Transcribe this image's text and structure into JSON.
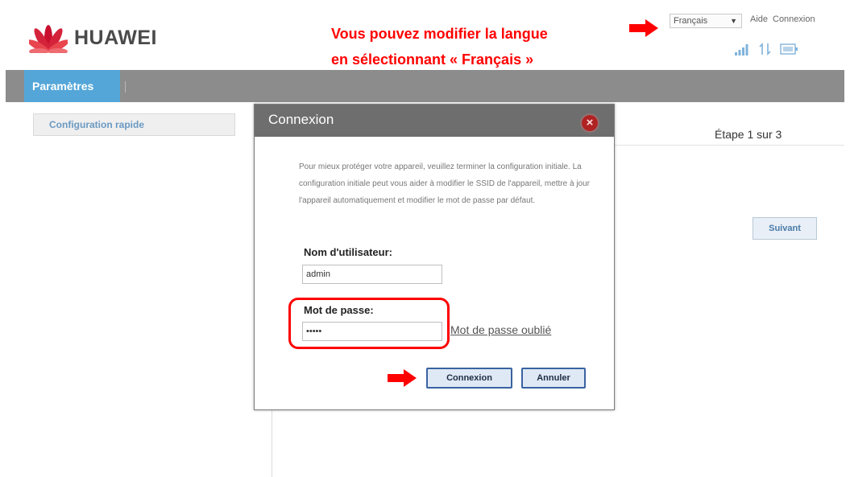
{
  "brand": {
    "name": "HUAWEI",
    "colors": {
      "petal_dark": "#c8102e",
      "petal_light": "#e8454f",
      "text": "#4a4a4a"
    }
  },
  "annotation": {
    "line1": "Vous pouvez modifier la langue",
    "line2": "en sélectionnant « Français »",
    "color": "#ff0000",
    "arrow_icons": [
      "right-arrow-icon",
      "right-arrow-icon"
    ]
  },
  "top_links": {
    "language": "Français",
    "help": "Aide",
    "login": "Connexion"
  },
  "status_icons": [
    "signal-icon",
    "data-transfer-icon",
    "network-type-icon"
  ],
  "nav": {
    "tab": "Paramètres"
  },
  "sidebar": {
    "items": [
      {
        "label": "Configuration rapide"
      }
    ]
  },
  "wizard": {
    "step_label": "Étape 1 sur 3",
    "next_button": "Suivant"
  },
  "dialog": {
    "title": "Connexion",
    "description": "Pour mieux protéger votre appareil, veuillez terminer la configuration initiale. La configuration initiale peut vous aider à modifier le SSID de l'appareil, mettre à jour l'appareil automatiquement et modifier le mot de passe par défaut.",
    "username_label": "Nom d'utilisateur:",
    "username_value": "admin",
    "password_label": "Mot de passe:",
    "password_value": "•••••",
    "forgot_link": "Mot de passe oublié",
    "connect_button": "Connexion",
    "cancel_button": "Annuler"
  }
}
